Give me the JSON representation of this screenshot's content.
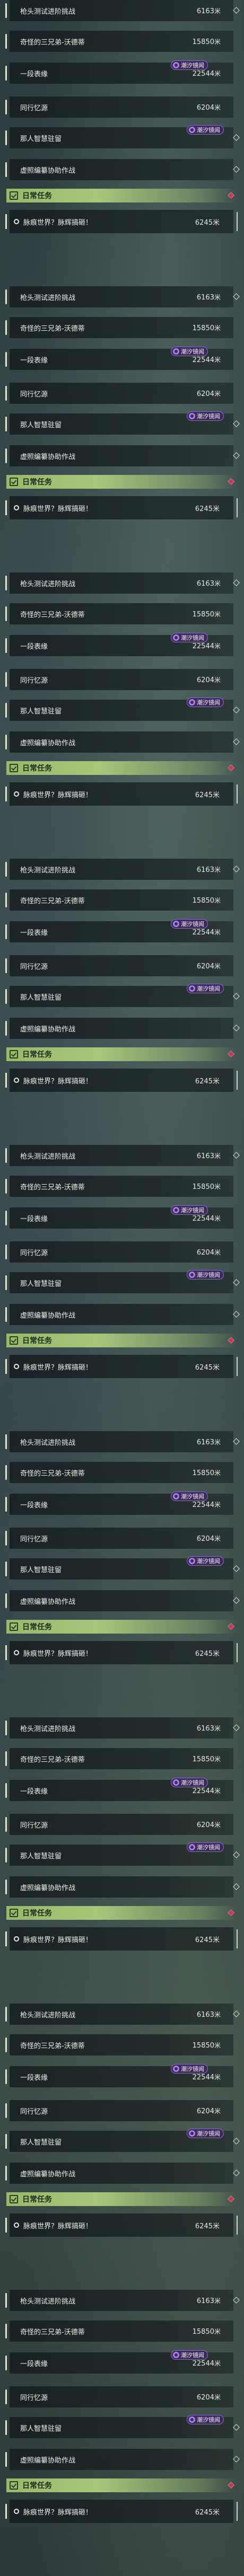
{
  "unit": "米",
  "quests": [
    {
      "title": "枪头测试进阶挑战",
      "distance": "6163"
    },
    {
      "title": "奇怪的三兄弟-沃德蒂",
      "distance": "15850"
    },
    {
      "title": "一段表缘",
      "distance": "22544",
      "badge": "潮汐镜闻"
    },
    {
      "title": "同行忆源",
      "distance": "6204",
      "selected": true
    },
    {
      "title": "那人智慧驻留",
      "distance": "",
      "badge": "潮汐镜闻"
    },
    {
      "title": "虚照编纂协助作战",
      "distance": ""
    }
  ],
  "section": {
    "title": "日常任务"
  },
  "daily": {
    "title": "脉痕世界？脉辉搞砸！",
    "distance": "6245"
  },
  "repeat_count": 9
}
